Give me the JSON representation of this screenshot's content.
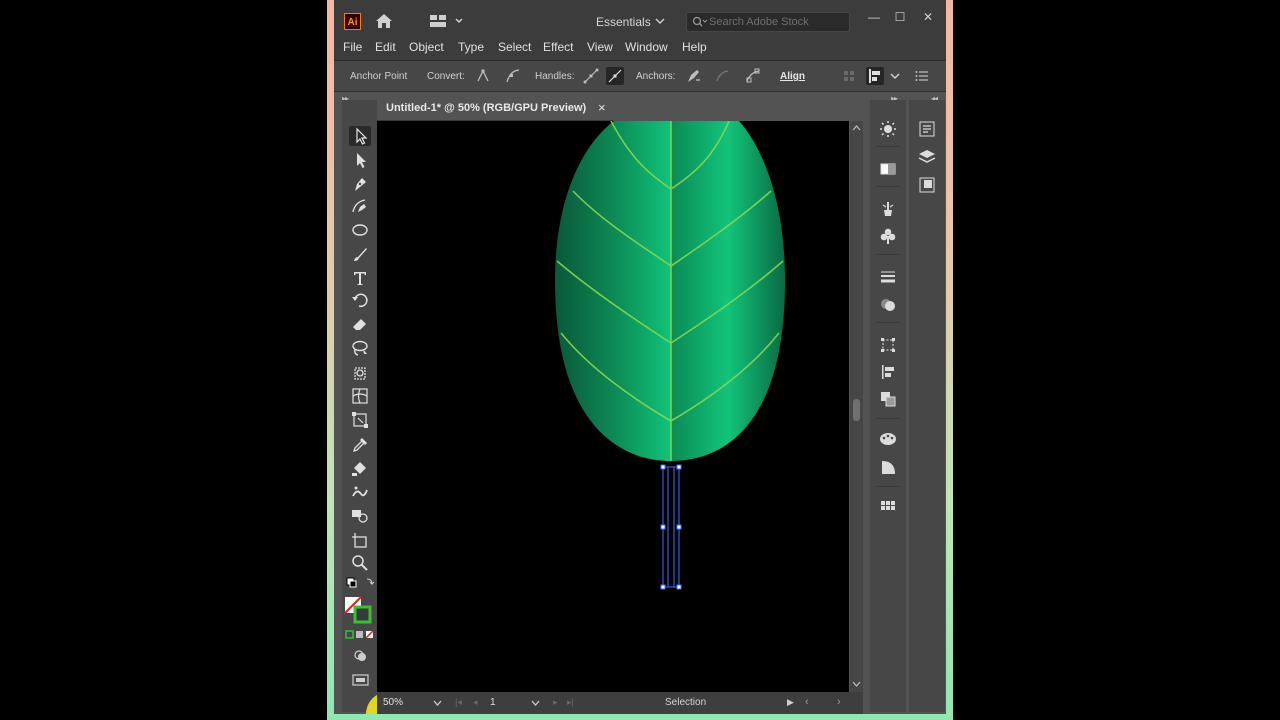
{
  "app": {
    "logo": "Ai",
    "workspace": "Essentials",
    "search_placeholder": "Search Adobe Stock"
  },
  "window_controls": {
    "minimize": "—",
    "maximize": "☐",
    "close": "✕"
  },
  "menu": [
    "File",
    "Edit",
    "Object",
    "Type",
    "Select",
    "Effect",
    "View",
    "Window",
    "Help"
  ],
  "control_bar": {
    "anchor_point": "Anchor Point",
    "convert": "Convert:",
    "handles": "Handles:",
    "anchors": "Anchors:",
    "align": "Align"
  },
  "document": {
    "tab_title": "Untitled-1* @ 50% (RGB/GPU Preview)",
    "close": "×"
  },
  "status_bar": {
    "zoom": "50%",
    "artboard": "1",
    "status": "Selection"
  },
  "colors": {
    "leaf_light": "#10c47a",
    "leaf_dark": "#0a5a3a",
    "vein": "#86d84f",
    "selection": "#3f6fff",
    "cursor_highlight": "#f8e81e"
  },
  "tools": [
    "selection-tool-icon",
    "direct-selection-tool-icon",
    "pen-tool-icon",
    "curvature-tool-icon",
    "ellipse-tool-icon",
    "paintbrush-tool-icon",
    "type-tool-icon",
    "rotate-tool-icon",
    "eraser-tool-icon",
    "lasso-tool-icon",
    "puppet-warp-tool-icon",
    "mesh-tool-icon",
    "free-transform-tool-icon",
    "eyedropper-tool-icon",
    "live-paint-bucket-tool-icon",
    "symbol-sprayer-tool-icon",
    "shape-builder-tool-icon",
    "artboard-tool-icon",
    "zoom-tool-icon"
  ]
}
